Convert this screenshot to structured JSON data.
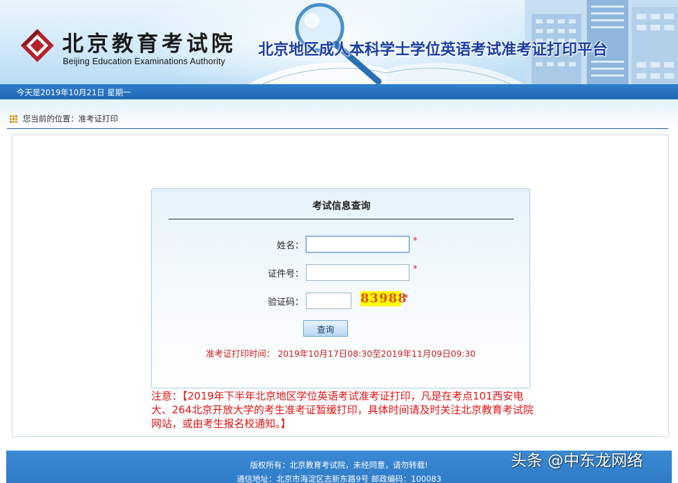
{
  "header": {
    "logo_cn": "北京教育考试院",
    "logo_en": "Beijing Education Examinations Authority",
    "platform_title": "北京地区成人本科学士学位英语考试准考证打印平台"
  },
  "date_bar": {
    "text": "今天是2019年10月21日 星期一"
  },
  "breadcrumb": {
    "label": "您当前的位置：",
    "current": "准考证打印"
  },
  "query_form": {
    "title": "考试信息查询",
    "name_label": "姓名：",
    "name_value": "",
    "id_label": "证件号：",
    "id_value": "",
    "captcha_label": "验证码：",
    "captcha_value": "",
    "captcha_code": "83988",
    "required_mark": "*",
    "submit_label": "查询",
    "print_time": "准考证打印时间： 2019年10月17日08:30至2019年11月09日09:30"
  },
  "notice": "注意：【2019年下半年北京地区学位英语考试准考证打印，凡是在考点101西安电大、264北京开放大学的考生准考证暂缓打印，具体时间请及时关注北京教育考试院网站，或由考生报名校通知。】",
  "footer": {
    "copyright": "版权所有：北京教育考试院，未经同意，请勿转载!",
    "address": "通信地址：北京市海淀区志新东路9号 邮政编码：100083"
  },
  "watermark": "头条 @中东龙网络",
  "colors": {
    "accent_blue": "#1f67b6",
    "title_blue": "#1a3ea0",
    "alert_red": "#e01515",
    "captcha_bg": "#ffff00",
    "captcha_text": "#e05000"
  }
}
